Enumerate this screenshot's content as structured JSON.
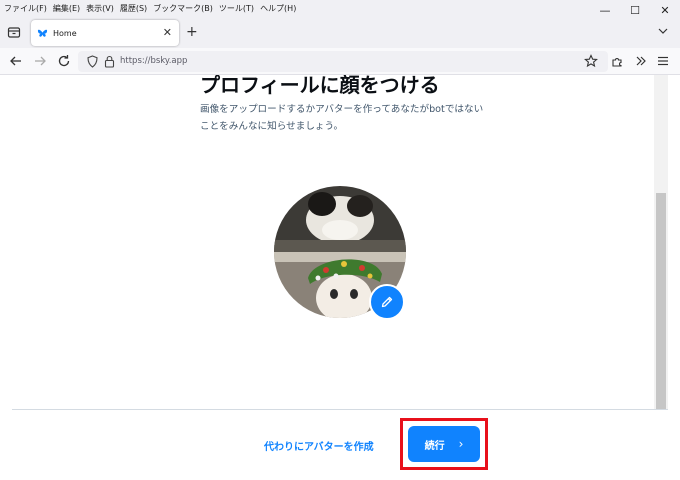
{
  "menubar": {
    "items": [
      "ファイル(F)",
      "編集(E)",
      "表示(V)",
      "履歴(S)",
      "ブックマーク(B)",
      "ツール(T)",
      "ヘルプ(H)"
    ]
  },
  "window_controls": {
    "minimize": "—",
    "maximize": "☐",
    "close": "✕"
  },
  "tabs": [
    {
      "title": "Home",
      "icon": "butterfly-icon"
    }
  ],
  "tab_bar": {
    "new_tab": "+",
    "close": "✕"
  },
  "navbar": {
    "url": "https://bsky.app"
  },
  "page": {
    "heading": "プロフィールに顔をつける",
    "subtitle": "画像をアップロードするかアバターを作ってあなたがbotではないことをみんなに知らせましょう。",
    "alt_link": "代わりにアバターを作成",
    "continue_label": "続行",
    "continue_chevron": "›"
  },
  "colors": {
    "accent": "#1083fe",
    "highlight": "#e8101b",
    "heading": "#0b0f14",
    "subtext": "#42576c"
  }
}
